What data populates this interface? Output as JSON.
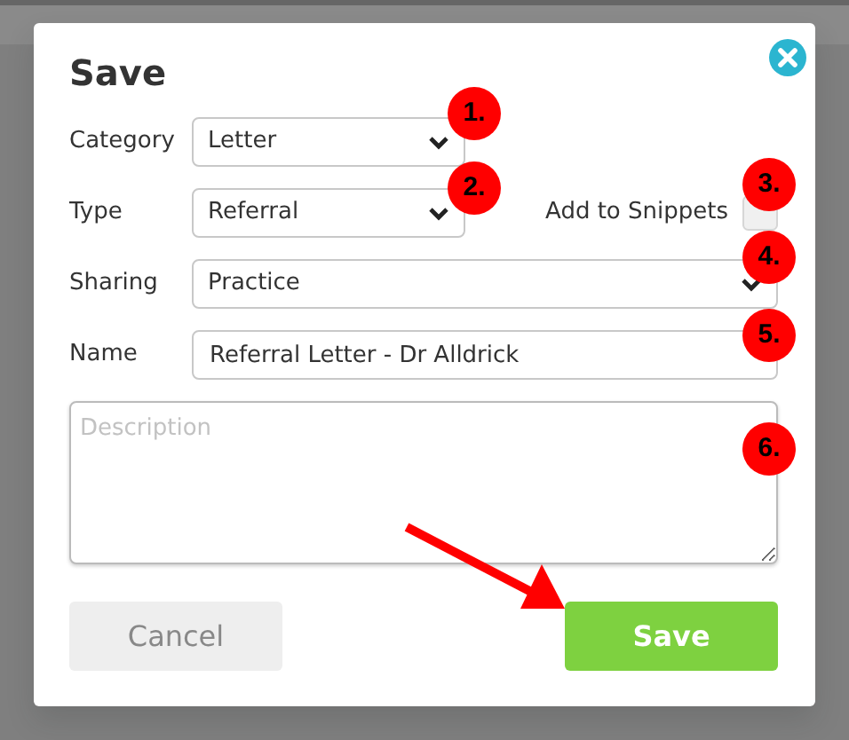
{
  "dialog": {
    "title": "Save",
    "category": {
      "label": "Category",
      "value": "Letter"
    },
    "type": {
      "label": "Type",
      "value": "Referral"
    },
    "add_to_snippets": {
      "label": "Add to Snippets",
      "checked": false
    },
    "sharing": {
      "label": "Sharing",
      "value": "Practice"
    },
    "name": {
      "label": "Name",
      "value": "Referral Letter - Dr Alldrick"
    },
    "description": {
      "placeholder": "Description"
    },
    "buttons": [
      {
        "label": "Cancel",
        "kind": "secondary"
      },
      {
        "label": "Save",
        "kind": "primary"
      }
    ]
  },
  "annotations": [
    {
      "label": "1."
    },
    {
      "label": "2."
    },
    {
      "label": "3."
    },
    {
      "label": "4."
    },
    {
      "label": "5."
    },
    {
      "label": "6."
    }
  ]
}
